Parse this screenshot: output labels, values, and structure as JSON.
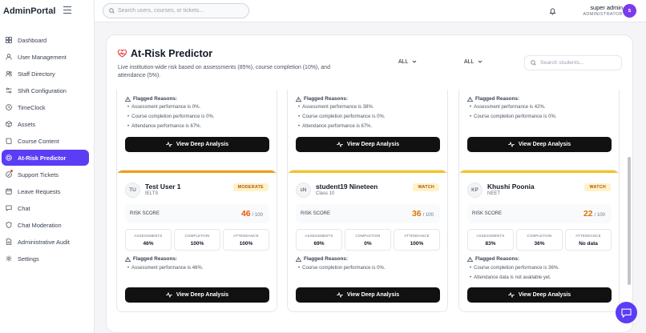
{
  "app": {
    "brand": "AdminPortal"
  },
  "sidebar": {
    "items": [
      {
        "label": "Dashboard",
        "icon": "grid-icon"
      },
      {
        "label": "User Management",
        "icon": "user-icon"
      },
      {
        "label": "Staff Directory",
        "icon": "users-icon"
      },
      {
        "label": "Shift Configuration",
        "icon": "sliders-icon"
      },
      {
        "label": "TimeClock",
        "icon": "clock-icon"
      },
      {
        "label": "Assets",
        "icon": "box-icon"
      },
      {
        "label": "Course Content",
        "icon": "book-icon"
      },
      {
        "label": "At-Risk Predictor",
        "icon": "target-icon",
        "active": true
      },
      {
        "label": "Support Tickets",
        "icon": "ticket-icon"
      },
      {
        "label": "Leave Requests",
        "icon": "calendar-icon"
      },
      {
        "label": "Chat",
        "icon": "chat-icon"
      },
      {
        "label": "Chat Moderation",
        "icon": "shield-icon"
      },
      {
        "label": "Administrative Audit",
        "icon": "audit-icon"
      },
      {
        "label": "Settings",
        "icon": "gear-icon"
      }
    ]
  },
  "header": {
    "search_placeholder": "Search users, courses, or tickets...",
    "user_name": "super admin",
    "user_role": "ADMINISTRATOR",
    "avatar_initial": "s"
  },
  "page": {
    "title": "At-Risk Predictor",
    "description": "Live institution-wide risk based on assessments (85%), course completion (10%), and attendance (5%).",
    "filter1": "ALL",
    "filter2": "ALL",
    "search_placeholder": "Search students..."
  },
  "labels": {
    "flagged_reasons": "Flagged Reasons:",
    "deep_analysis": "View Deep Analysis",
    "risk_score": "RISK SCORE",
    "out_of": "/ 100",
    "assessments": "ASSESSMENTS",
    "completion": "COMPLETION",
    "attendance": "ATTENDANCE"
  },
  "top_cards": [
    {
      "reasons": [
        "Assessment performance is 0%.",
        "Course completion performance is 0%.",
        "Attendance performance is 67%."
      ]
    },
    {
      "reasons": [
        "Assessment performance is 38%.",
        "Course completion performance is 0%.",
        "Attendance performance is 67%."
      ]
    },
    {
      "reasons": [
        "Assessment performance is 42%.",
        "Course completion performance is 0%."
      ]
    }
  ],
  "students": [
    {
      "initials": "TU",
      "name": "Test User 1",
      "sub": "IELTS",
      "badge": "MODERATE",
      "score": "46",
      "assessments": "46%",
      "completion": "100%",
      "attendance": "100%",
      "reasons": [
        "Assessment performance is 46%."
      ]
    },
    {
      "initials": "sN",
      "name": "student19 Nineteen",
      "sub": "Class 10",
      "badge": "WATCH",
      "score": "36",
      "assessments": "69%",
      "completion": "0%",
      "attendance": "100%",
      "reasons": [
        "Course completion performance is 0%."
      ]
    },
    {
      "initials": "KP",
      "name": "Khushi Poonia",
      "sub": "NEET",
      "badge": "WATCH",
      "score": "22",
      "assessments": "83%",
      "completion": "36%",
      "attendance": "No data",
      "reasons": [
        "Course completion performance is 36%.",
        "Attendance data is not available yet."
      ]
    }
  ],
  "colors": {
    "accent": "#5b3df5",
    "moderate_bar": "#f59e0b",
    "watch_bar": "#f5c518",
    "moderate_score": "#ea580c",
    "watch_score": "#d97706",
    "badge_bg": "#fef3c7",
    "badge_text": "#b45309"
  }
}
